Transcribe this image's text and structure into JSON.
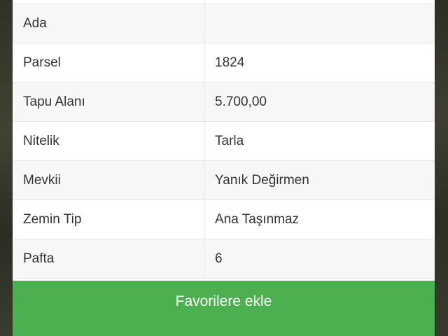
{
  "details": {
    "rows": [
      {
        "label": "Ada",
        "value": ""
      },
      {
        "label": "Parsel",
        "value": "1824"
      },
      {
        "label": "Tapu Alanı",
        "value": "5.700,00"
      },
      {
        "label": "Nitelik",
        "value": "Tarla"
      },
      {
        "label": "Mevkii",
        "value": "Yanık Değirmen"
      },
      {
        "label": "Zemin Tip",
        "value": "Ana Taşınmaz"
      },
      {
        "label": "Pafta",
        "value": "6"
      }
    ]
  },
  "actions": {
    "favorite_label": "Favorilere ekle"
  },
  "colors": {
    "button_green": "#4caf50",
    "row_alt": "#f7f7f7",
    "text": "#333333"
  }
}
